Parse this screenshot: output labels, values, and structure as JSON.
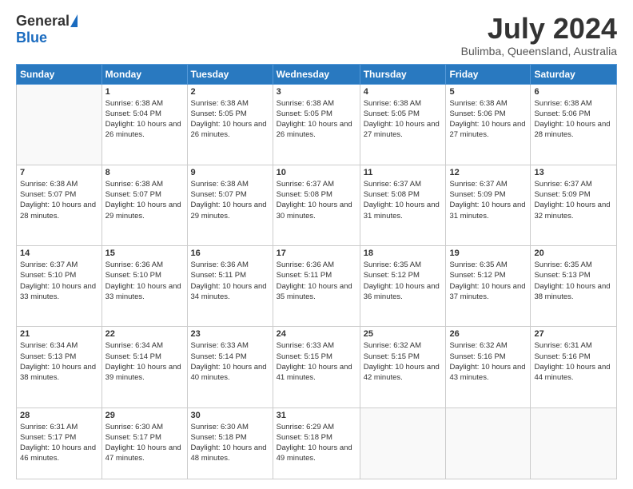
{
  "header": {
    "logo_general": "General",
    "logo_blue": "Blue",
    "month_title": "July 2024",
    "location": "Bulimba, Queensland, Australia"
  },
  "days_of_week": [
    "Sunday",
    "Monday",
    "Tuesday",
    "Wednesday",
    "Thursday",
    "Friday",
    "Saturday"
  ],
  "weeks": [
    [
      {
        "day": "",
        "sunrise": "",
        "sunset": "",
        "daylight": ""
      },
      {
        "day": "1",
        "sunrise": "Sunrise: 6:38 AM",
        "sunset": "Sunset: 5:04 PM",
        "daylight": "Daylight: 10 hours and 26 minutes."
      },
      {
        "day": "2",
        "sunrise": "Sunrise: 6:38 AM",
        "sunset": "Sunset: 5:05 PM",
        "daylight": "Daylight: 10 hours and 26 minutes."
      },
      {
        "day": "3",
        "sunrise": "Sunrise: 6:38 AM",
        "sunset": "Sunset: 5:05 PM",
        "daylight": "Daylight: 10 hours and 26 minutes."
      },
      {
        "day": "4",
        "sunrise": "Sunrise: 6:38 AM",
        "sunset": "Sunset: 5:05 PM",
        "daylight": "Daylight: 10 hours and 27 minutes."
      },
      {
        "day": "5",
        "sunrise": "Sunrise: 6:38 AM",
        "sunset": "Sunset: 5:06 PM",
        "daylight": "Daylight: 10 hours and 27 minutes."
      },
      {
        "day": "6",
        "sunrise": "Sunrise: 6:38 AM",
        "sunset": "Sunset: 5:06 PM",
        "daylight": "Daylight: 10 hours and 28 minutes."
      }
    ],
    [
      {
        "day": "7",
        "sunrise": "Sunrise: 6:38 AM",
        "sunset": "Sunset: 5:07 PM",
        "daylight": "Daylight: 10 hours and 28 minutes."
      },
      {
        "day": "8",
        "sunrise": "Sunrise: 6:38 AM",
        "sunset": "Sunset: 5:07 PM",
        "daylight": "Daylight: 10 hours and 29 minutes."
      },
      {
        "day": "9",
        "sunrise": "Sunrise: 6:38 AM",
        "sunset": "Sunset: 5:07 PM",
        "daylight": "Daylight: 10 hours and 29 minutes."
      },
      {
        "day": "10",
        "sunrise": "Sunrise: 6:37 AM",
        "sunset": "Sunset: 5:08 PM",
        "daylight": "Daylight: 10 hours and 30 minutes."
      },
      {
        "day": "11",
        "sunrise": "Sunrise: 6:37 AM",
        "sunset": "Sunset: 5:08 PM",
        "daylight": "Daylight: 10 hours and 31 minutes."
      },
      {
        "day": "12",
        "sunrise": "Sunrise: 6:37 AM",
        "sunset": "Sunset: 5:09 PM",
        "daylight": "Daylight: 10 hours and 31 minutes."
      },
      {
        "day": "13",
        "sunrise": "Sunrise: 6:37 AM",
        "sunset": "Sunset: 5:09 PM",
        "daylight": "Daylight: 10 hours and 32 minutes."
      }
    ],
    [
      {
        "day": "14",
        "sunrise": "Sunrise: 6:37 AM",
        "sunset": "Sunset: 5:10 PM",
        "daylight": "Daylight: 10 hours and 33 minutes."
      },
      {
        "day": "15",
        "sunrise": "Sunrise: 6:36 AM",
        "sunset": "Sunset: 5:10 PM",
        "daylight": "Daylight: 10 hours and 33 minutes."
      },
      {
        "day": "16",
        "sunrise": "Sunrise: 6:36 AM",
        "sunset": "Sunset: 5:11 PM",
        "daylight": "Daylight: 10 hours and 34 minutes."
      },
      {
        "day": "17",
        "sunrise": "Sunrise: 6:36 AM",
        "sunset": "Sunset: 5:11 PM",
        "daylight": "Daylight: 10 hours and 35 minutes."
      },
      {
        "day": "18",
        "sunrise": "Sunrise: 6:35 AM",
        "sunset": "Sunset: 5:12 PM",
        "daylight": "Daylight: 10 hours and 36 minutes."
      },
      {
        "day": "19",
        "sunrise": "Sunrise: 6:35 AM",
        "sunset": "Sunset: 5:12 PM",
        "daylight": "Daylight: 10 hours and 37 minutes."
      },
      {
        "day": "20",
        "sunrise": "Sunrise: 6:35 AM",
        "sunset": "Sunset: 5:13 PM",
        "daylight": "Daylight: 10 hours and 38 minutes."
      }
    ],
    [
      {
        "day": "21",
        "sunrise": "Sunrise: 6:34 AM",
        "sunset": "Sunset: 5:13 PM",
        "daylight": "Daylight: 10 hours and 38 minutes."
      },
      {
        "day": "22",
        "sunrise": "Sunrise: 6:34 AM",
        "sunset": "Sunset: 5:14 PM",
        "daylight": "Daylight: 10 hours and 39 minutes."
      },
      {
        "day": "23",
        "sunrise": "Sunrise: 6:33 AM",
        "sunset": "Sunset: 5:14 PM",
        "daylight": "Daylight: 10 hours and 40 minutes."
      },
      {
        "day": "24",
        "sunrise": "Sunrise: 6:33 AM",
        "sunset": "Sunset: 5:15 PM",
        "daylight": "Daylight: 10 hours and 41 minutes."
      },
      {
        "day": "25",
        "sunrise": "Sunrise: 6:32 AM",
        "sunset": "Sunset: 5:15 PM",
        "daylight": "Daylight: 10 hours and 42 minutes."
      },
      {
        "day": "26",
        "sunrise": "Sunrise: 6:32 AM",
        "sunset": "Sunset: 5:16 PM",
        "daylight": "Daylight: 10 hours and 43 minutes."
      },
      {
        "day": "27",
        "sunrise": "Sunrise: 6:31 AM",
        "sunset": "Sunset: 5:16 PM",
        "daylight": "Daylight: 10 hours and 44 minutes."
      }
    ],
    [
      {
        "day": "28",
        "sunrise": "Sunrise: 6:31 AM",
        "sunset": "Sunset: 5:17 PM",
        "daylight": "Daylight: 10 hours and 46 minutes."
      },
      {
        "day": "29",
        "sunrise": "Sunrise: 6:30 AM",
        "sunset": "Sunset: 5:17 PM",
        "daylight": "Daylight: 10 hours and 47 minutes."
      },
      {
        "day": "30",
        "sunrise": "Sunrise: 6:30 AM",
        "sunset": "Sunset: 5:18 PM",
        "daylight": "Daylight: 10 hours and 48 minutes."
      },
      {
        "day": "31",
        "sunrise": "Sunrise: 6:29 AM",
        "sunset": "Sunset: 5:18 PM",
        "daylight": "Daylight: 10 hours and 49 minutes."
      },
      {
        "day": "",
        "sunrise": "",
        "sunset": "",
        "daylight": ""
      },
      {
        "day": "",
        "sunrise": "",
        "sunset": "",
        "daylight": ""
      },
      {
        "day": "",
        "sunrise": "",
        "sunset": "",
        "daylight": ""
      }
    ]
  ]
}
